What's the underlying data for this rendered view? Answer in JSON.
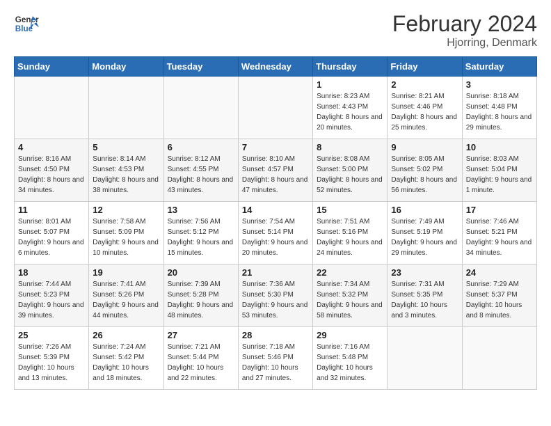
{
  "logo": {
    "line1": "General",
    "line2": "Blue"
  },
  "title": "February 2024",
  "location": "Hjorring, Denmark",
  "days_of_week": [
    "Sunday",
    "Monday",
    "Tuesday",
    "Wednesday",
    "Thursday",
    "Friday",
    "Saturday"
  ],
  "weeks": [
    [
      {
        "day": "",
        "sunrise": "",
        "sunset": "",
        "daylight": ""
      },
      {
        "day": "",
        "sunrise": "",
        "sunset": "",
        "daylight": ""
      },
      {
        "day": "",
        "sunrise": "",
        "sunset": "",
        "daylight": ""
      },
      {
        "day": "",
        "sunrise": "",
        "sunset": "",
        "daylight": ""
      },
      {
        "day": "1",
        "sunrise": "Sunrise: 8:23 AM",
        "sunset": "Sunset: 4:43 PM",
        "daylight": "Daylight: 8 hours and 20 minutes."
      },
      {
        "day": "2",
        "sunrise": "Sunrise: 8:21 AM",
        "sunset": "Sunset: 4:46 PM",
        "daylight": "Daylight: 8 hours and 25 minutes."
      },
      {
        "day": "3",
        "sunrise": "Sunrise: 8:18 AM",
        "sunset": "Sunset: 4:48 PM",
        "daylight": "Daylight: 8 hours and 29 minutes."
      }
    ],
    [
      {
        "day": "4",
        "sunrise": "Sunrise: 8:16 AM",
        "sunset": "Sunset: 4:50 PM",
        "daylight": "Daylight: 8 hours and 34 minutes."
      },
      {
        "day": "5",
        "sunrise": "Sunrise: 8:14 AM",
        "sunset": "Sunset: 4:53 PM",
        "daylight": "Daylight: 8 hours and 38 minutes."
      },
      {
        "day": "6",
        "sunrise": "Sunrise: 8:12 AM",
        "sunset": "Sunset: 4:55 PM",
        "daylight": "Daylight: 8 hours and 43 minutes."
      },
      {
        "day": "7",
        "sunrise": "Sunrise: 8:10 AM",
        "sunset": "Sunset: 4:57 PM",
        "daylight": "Daylight: 8 hours and 47 minutes."
      },
      {
        "day": "8",
        "sunrise": "Sunrise: 8:08 AM",
        "sunset": "Sunset: 5:00 PM",
        "daylight": "Daylight: 8 hours and 52 minutes."
      },
      {
        "day": "9",
        "sunrise": "Sunrise: 8:05 AM",
        "sunset": "Sunset: 5:02 PM",
        "daylight": "Daylight: 8 hours and 56 minutes."
      },
      {
        "day": "10",
        "sunrise": "Sunrise: 8:03 AM",
        "sunset": "Sunset: 5:04 PM",
        "daylight": "Daylight: 9 hours and 1 minute."
      }
    ],
    [
      {
        "day": "11",
        "sunrise": "Sunrise: 8:01 AM",
        "sunset": "Sunset: 5:07 PM",
        "daylight": "Daylight: 9 hours and 6 minutes."
      },
      {
        "day": "12",
        "sunrise": "Sunrise: 7:58 AM",
        "sunset": "Sunset: 5:09 PM",
        "daylight": "Daylight: 9 hours and 10 minutes."
      },
      {
        "day": "13",
        "sunrise": "Sunrise: 7:56 AM",
        "sunset": "Sunset: 5:12 PM",
        "daylight": "Daylight: 9 hours and 15 minutes."
      },
      {
        "day": "14",
        "sunrise": "Sunrise: 7:54 AM",
        "sunset": "Sunset: 5:14 PM",
        "daylight": "Daylight: 9 hours and 20 minutes."
      },
      {
        "day": "15",
        "sunrise": "Sunrise: 7:51 AM",
        "sunset": "Sunset: 5:16 PM",
        "daylight": "Daylight: 9 hours and 24 minutes."
      },
      {
        "day": "16",
        "sunrise": "Sunrise: 7:49 AM",
        "sunset": "Sunset: 5:19 PM",
        "daylight": "Daylight: 9 hours and 29 minutes."
      },
      {
        "day": "17",
        "sunrise": "Sunrise: 7:46 AM",
        "sunset": "Sunset: 5:21 PM",
        "daylight": "Daylight: 9 hours and 34 minutes."
      }
    ],
    [
      {
        "day": "18",
        "sunrise": "Sunrise: 7:44 AM",
        "sunset": "Sunset: 5:23 PM",
        "daylight": "Daylight: 9 hours and 39 minutes."
      },
      {
        "day": "19",
        "sunrise": "Sunrise: 7:41 AM",
        "sunset": "Sunset: 5:26 PM",
        "daylight": "Daylight: 9 hours and 44 minutes."
      },
      {
        "day": "20",
        "sunrise": "Sunrise: 7:39 AM",
        "sunset": "Sunset: 5:28 PM",
        "daylight": "Daylight: 9 hours and 48 minutes."
      },
      {
        "day": "21",
        "sunrise": "Sunrise: 7:36 AM",
        "sunset": "Sunset: 5:30 PM",
        "daylight": "Daylight: 9 hours and 53 minutes."
      },
      {
        "day": "22",
        "sunrise": "Sunrise: 7:34 AM",
        "sunset": "Sunset: 5:32 PM",
        "daylight": "Daylight: 9 hours and 58 minutes."
      },
      {
        "day": "23",
        "sunrise": "Sunrise: 7:31 AM",
        "sunset": "Sunset: 5:35 PM",
        "daylight": "Daylight: 10 hours and 3 minutes."
      },
      {
        "day": "24",
        "sunrise": "Sunrise: 7:29 AM",
        "sunset": "Sunset: 5:37 PM",
        "daylight": "Daylight: 10 hours and 8 minutes."
      }
    ],
    [
      {
        "day": "25",
        "sunrise": "Sunrise: 7:26 AM",
        "sunset": "Sunset: 5:39 PM",
        "daylight": "Daylight: 10 hours and 13 minutes."
      },
      {
        "day": "26",
        "sunrise": "Sunrise: 7:24 AM",
        "sunset": "Sunset: 5:42 PM",
        "daylight": "Daylight: 10 hours and 18 minutes."
      },
      {
        "day": "27",
        "sunrise": "Sunrise: 7:21 AM",
        "sunset": "Sunset: 5:44 PM",
        "daylight": "Daylight: 10 hours and 22 minutes."
      },
      {
        "day": "28",
        "sunrise": "Sunrise: 7:18 AM",
        "sunset": "Sunset: 5:46 PM",
        "daylight": "Daylight: 10 hours and 27 minutes."
      },
      {
        "day": "29",
        "sunrise": "Sunrise: 7:16 AM",
        "sunset": "Sunset: 5:48 PM",
        "daylight": "Daylight: 10 hours and 32 minutes."
      },
      {
        "day": "",
        "sunrise": "",
        "sunset": "",
        "daylight": ""
      },
      {
        "day": "",
        "sunrise": "",
        "sunset": "",
        "daylight": ""
      }
    ]
  ]
}
